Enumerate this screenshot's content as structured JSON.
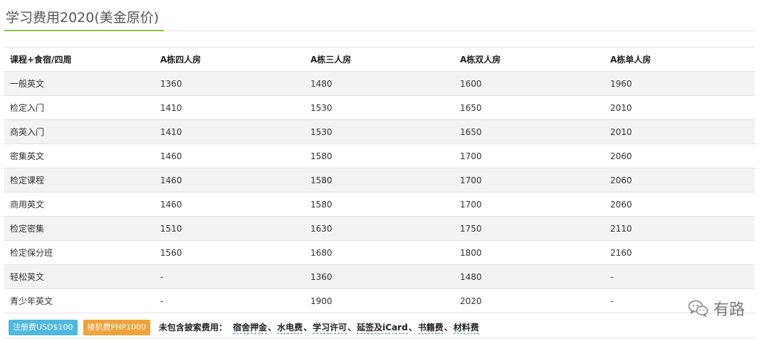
{
  "page": {
    "title": "学习费用2020(美金原价)"
  },
  "table": {
    "headers": [
      "课程+食宿/四周",
      "A栋四人房",
      "A栋三人房",
      "A栋双人房",
      "A栋单人房"
    ],
    "rows": [
      [
        "一般英文",
        "1360",
        "1480",
        "1600",
        "1960"
      ],
      [
        "检定入门",
        "1410",
        "1530",
        "1650",
        "2010"
      ],
      [
        "商英入门",
        "1410",
        "1530",
        "1650",
        "2010"
      ],
      [
        "密集英文",
        "1460",
        "1580",
        "1700",
        "2060"
      ],
      [
        "检定课程",
        "1460",
        "1580",
        "1700",
        "2060"
      ],
      [
        "商用英文",
        "1460",
        "1580",
        "1700",
        "2060"
      ],
      [
        "检定密集",
        "1510",
        "1630",
        "1750",
        "2110"
      ],
      [
        "检定保分班",
        "1560",
        "1680",
        "1800",
        "2160"
      ],
      [
        "轻松英文",
        "-",
        "1360",
        "1480",
        "-"
      ],
      [
        "青少年英文",
        "-",
        "1900",
        "2020",
        "-"
      ]
    ]
  },
  "footer": {
    "badges": [
      {
        "label": "注册费USD$100",
        "color": "#4fb8e0"
      },
      {
        "label": "接机费PHP1000",
        "color": "#f0a23c"
      }
    ],
    "note_label": "未包含披索费用：",
    "note_items": [
      "宿舍押金",
      "水电费",
      "学习许可",
      "延签及iCard",
      "书籍费",
      "材料费"
    ],
    "separator": "、"
  },
  "watermark": {
    "text": "有路",
    "icon": "wechat-icon"
  }
}
